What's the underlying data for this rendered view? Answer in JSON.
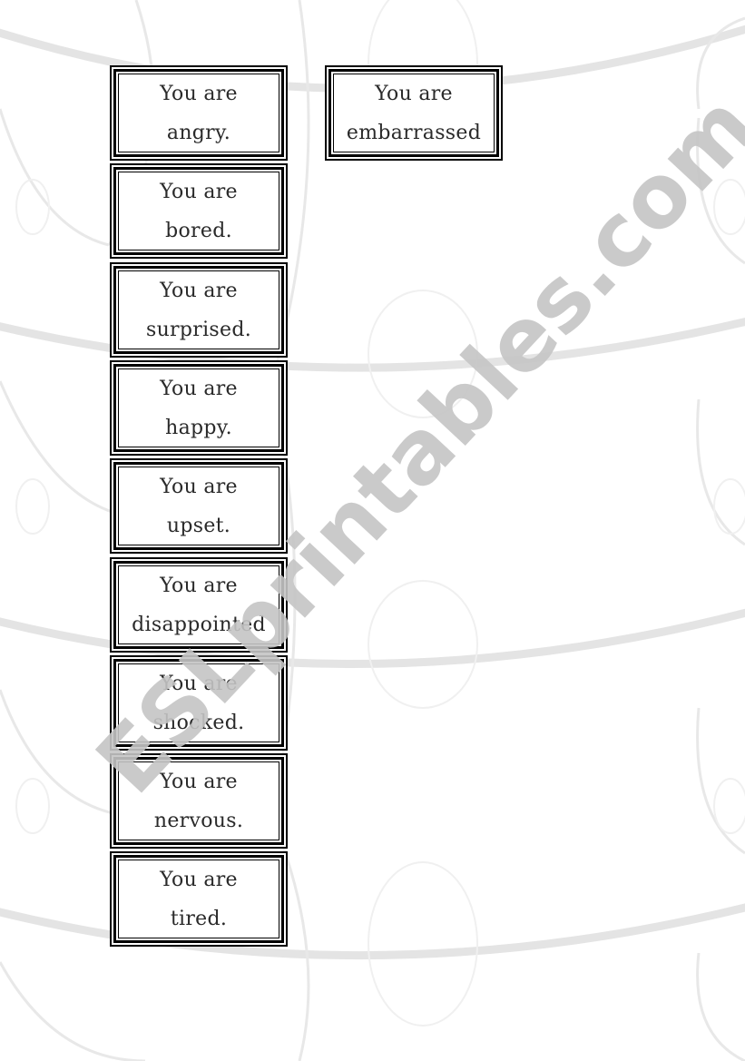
{
  "document": {
    "watermark_text": "ESLprintables.com",
    "watermark_color": "#c8c8c8",
    "border_color": "#000000",
    "text_color": "#2a2a2a"
  },
  "cards": [
    {
      "line1": "You are",
      "line2": "angry."
    },
    {
      "line1": "You are",
      "line2": "bored."
    },
    {
      "line1": "You are",
      "line2": "surprised."
    },
    {
      "line1": "You are",
      "line2": "happy."
    },
    {
      "line1": "You are",
      "line2": "upset."
    },
    {
      "line1": "You are",
      "line2": "disappointed"
    },
    {
      "line1": "You are",
      "line2": "shocked."
    },
    {
      "line1": "You are",
      "line2": "nervous."
    },
    {
      "line1": "You are",
      "line2": "tired."
    },
    {
      "line1": "You are",
      "line2": "embarrassed"
    }
  ]
}
